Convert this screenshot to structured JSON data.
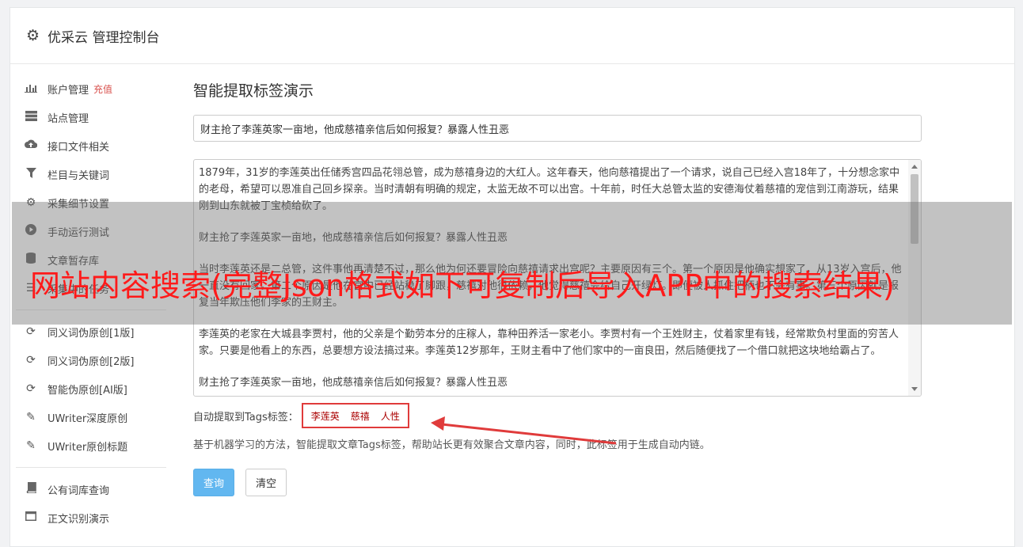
{
  "header": {
    "title": "优采云 管理控制台",
    "icon": "gear-icon"
  },
  "sidebar": {
    "items": [
      {
        "icon": "bar-chart-icon",
        "label": "账户管理",
        "badge": "充值"
      },
      {
        "icon": "server-icon",
        "label": "站点管理"
      },
      {
        "icon": "cloud-upload-icon",
        "label": "接口文件相关"
      },
      {
        "icon": "filter-icon",
        "label": "栏目与关键词"
      },
      {
        "icon": "cogs-icon",
        "label": "采集细节设置"
      },
      {
        "icon": "play-circle-icon",
        "label": "手动运行测试"
      },
      {
        "icon": "database-icon",
        "label": "文章暂存库"
      },
      {
        "icon": "task-icon",
        "label": "采集中的任务"
      }
    ],
    "items2": [
      {
        "icon": "refresh-icon",
        "label": "同义词伪原创[1版]"
      },
      {
        "icon": "refresh-icon",
        "label": "同义词伪原创[2版]"
      },
      {
        "icon": "refresh-icon",
        "label": "智能伪原创[AI版]"
      },
      {
        "icon": "edit-icon",
        "label": "UWriter深度原创"
      },
      {
        "icon": "edit-icon",
        "label": "UWriter原创标题"
      }
    ],
    "items3": [
      {
        "icon": "book-icon",
        "label": "公有词库查询"
      },
      {
        "icon": "window-icon",
        "label": "正文识别演示"
      }
    ]
  },
  "main": {
    "section_title": "智能提取标签演示",
    "title_value": "财主抢了李莲英家一亩地，他成慈禧亲信后如何报复？暴露人性丑恶",
    "content_paragraphs": [
      "1879年，31岁的李莲英出任储秀宫四品花翎总管，成为慈禧身边的大红人。这年春天，他向慈禧提出了一个请求，说自己已经入宫18年了，十分想念家中的老母，希望可以恩准自己回乡探亲。当时清朝有明确的规定，太监无故不可以出宫。十年前，时任大总管太监的安德海仗着慈禧的宠信到江南游玩，结果刚到山东就被丁宝桢给砍了。",
      "财主抢了李莲英家一亩地，他成慈禧亲信后如何报复？暴露人性丑恶",
      "当时李莲英还是二总管，这件事他再清楚不过，那么他为何还要冒险向慈禧请求出宫呢？主要原因有三个。第一个原因是他确实想家了，从13岁入宫后，他一直没有回家。第二个原因是他在宫中已经站稳了脚跟，慈禧对他很依赖，他觉得慈禧会给自己开绿灯。即便被人抓住把柄也不会有事。第三个原因就是报复当年欺压他们李家的王财主。",
      "李莲英的老家在大城县李贾村，他的父亲是个勤劳本分的庄稼人，靠种田养活一家老小。李贾村有一个王姓财主，仗着家里有钱，经常欺负村里面的穷苦人家。只要是他看上的东西，总要想方设法搞过来。李莲英12岁那年，王财主看中了他们家中的一亩良田，然后随便找了一个借口就把这块地给霸占了。",
      "财主抢了李莲英家一亩地，他成慈禧亲信后如何报复？暴露人性丑恶"
    ],
    "tags_label": "自动提取到Tags标签：",
    "tags": [
      "李莲英",
      "慈禧",
      "人性"
    ],
    "description": "基于机器学习的方法，智能提取文章Tags标签，帮助站长更有效聚合文章内容，同时，此标签用于生成自动内链。",
    "query_button": "查询",
    "clear_button": "清空"
  },
  "overlay": {
    "text": "网站内容搜索(完整Json格式如下可复制后导入APP中的搜索结果)"
  },
  "colors": {
    "accent": "#62b7f0",
    "annotation": "#e03b3b",
    "badge": "#d9534f"
  }
}
